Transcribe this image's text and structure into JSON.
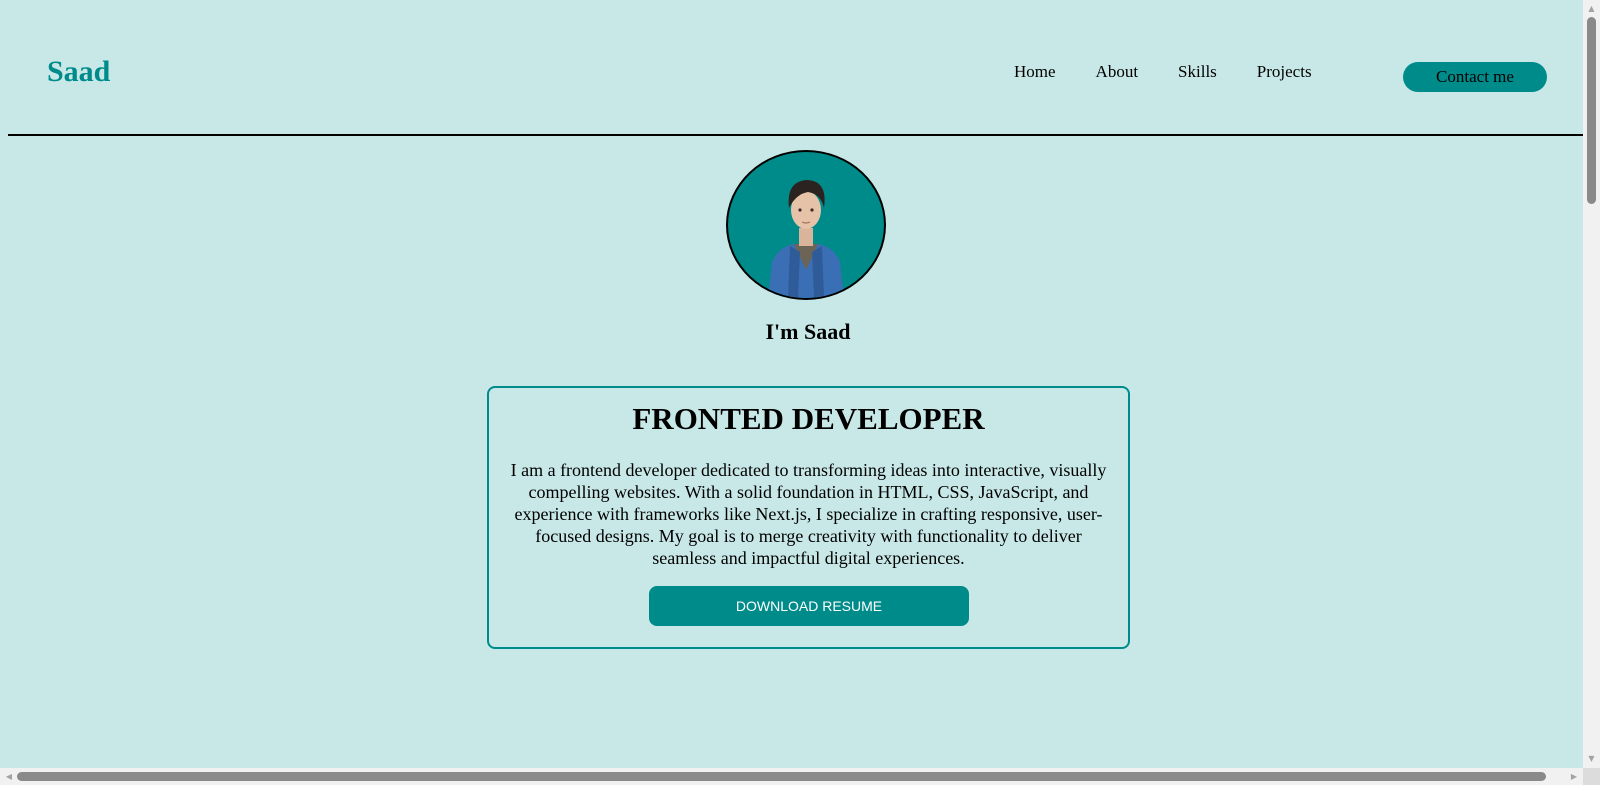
{
  "brand": "Saad",
  "nav": {
    "items": [
      "Home",
      "About",
      "Skills",
      "Projects"
    ],
    "contact_label": "Contact me"
  },
  "hero": {
    "avatar_icon": "avatar-portrait",
    "intro": "I'm Saad"
  },
  "card": {
    "title": "FRONTED DEVELOPER",
    "description": "I am a frontend developer dedicated to transforming ideas into interactive, visually compelling websites. With a solid foundation in HTML, CSS, JavaScript, and experience with frameworks like Next.js, I specialize in crafting responsive, user-focused designs. My goal is to merge creativity with functionality to deliver seamless and impactful digital experiences.",
    "button_label": "DOWNLOAD RESUME"
  },
  "colors": {
    "background": "#c8e8e8",
    "accent": "#008b8b"
  }
}
